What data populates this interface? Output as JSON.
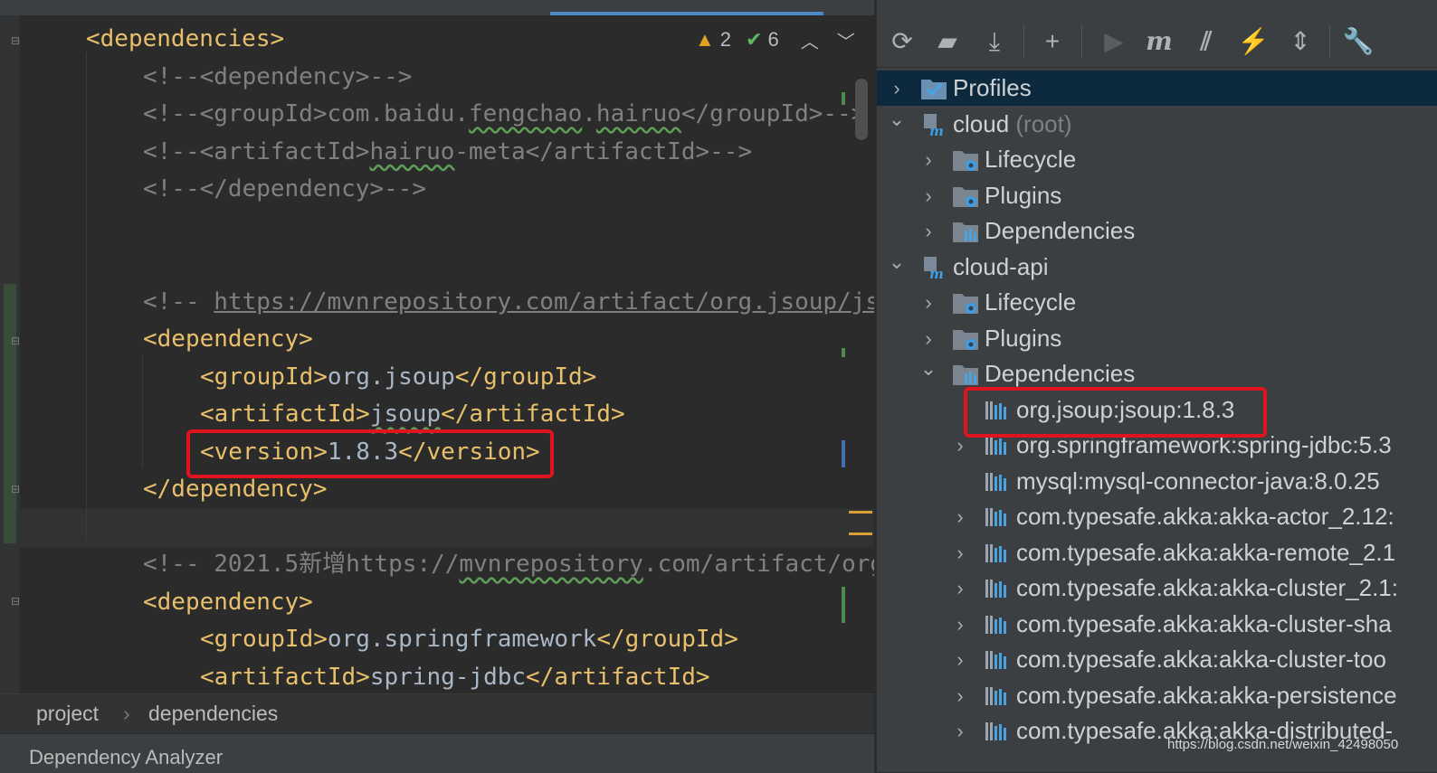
{
  "editor": {
    "inspection": {
      "warnings": "2",
      "ok": "6"
    },
    "lines": [
      {
        "segments": [
          {
            "t": "<dependencies>",
            "c": "tag"
          }
        ]
      },
      {
        "segments": [
          {
            "t": "<!--<dependency>-->",
            "c": "cmt"
          }
        ]
      },
      {
        "segments": [
          {
            "t": "<!--<groupId>com.baidu.",
            "c": "cmt"
          },
          {
            "t": "fengchao",
            "c": "cmt wavy"
          },
          {
            "t": ".",
            "c": "cmt"
          },
          {
            "t": "hairuo",
            "c": "cmt wavy"
          },
          {
            "t": "</groupId>-->",
            "c": "cmt"
          }
        ]
      },
      {
        "segments": [
          {
            "t": "<!--<artifactId>",
            "c": "cmt"
          },
          {
            "t": "hairuo",
            "c": "cmt wavy"
          },
          {
            "t": "-meta</artifactId>-->",
            "c": "cmt"
          }
        ]
      },
      {
        "segments": [
          {
            "t": "<!--</dependency>-->",
            "c": "cmt"
          }
        ]
      },
      {
        "segments": []
      },
      {
        "segments": []
      },
      {
        "segments": [
          {
            "t": "<!-- ",
            "c": "cmt"
          },
          {
            "t": "https://mvnrepository.com/artifact/org.jsoup/jsoup",
            "c": "url"
          }
        ]
      },
      {
        "segments": [
          {
            "t": "<dependency>",
            "c": "tag"
          }
        ]
      },
      {
        "segments": [
          {
            "t": "<groupId>",
            "c": "tag"
          },
          {
            "t": "org.jsoup",
            "c": "txt"
          },
          {
            "t": "</groupId>",
            "c": "tag"
          }
        ]
      },
      {
        "segments": [
          {
            "t": "<artifactId>",
            "c": "tag"
          },
          {
            "t": "jsoup",
            "c": "txt wavy"
          },
          {
            "t": "</artifactId>",
            "c": "tag"
          }
        ]
      },
      {
        "segments": [
          {
            "t": "<version>",
            "c": "tag"
          },
          {
            "t": "1.8.3",
            "c": "txt"
          },
          {
            "t": "</version>",
            "c": "tag"
          }
        ]
      },
      {
        "segments": [
          {
            "t": "</dependency>",
            "c": "tag"
          }
        ]
      },
      {
        "segments": []
      },
      {
        "segments": [
          {
            "t": "<!-- 2021.5新增https://",
            "c": "cmt"
          },
          {
            "t": "mvnrepository",
            "c": "cmt wavy"
          },
          {
            "t": ".com/artifact/org",
            "c": "cmt"
          }
        ]
      },
      {
        "segments": [
          {
            "t": "<dependency>",
            "c": "tag"
          }
        ]
      },
      {
        "segments": [
          {
            "t": "<groupId>",
            "c": "tag"
          },
          {
            "t": "org.springframework",
            "c": "txt"
          },
          {
            "t": "</groupId>",
            "c": "tag"
          }
        ]
      },
      {
        "segments": [
          {
            "t": "<artifactId>",
            "c": "tag"
          },
          {
            "t": "spring-jdbc",
            "c": "txt"
          },
          {
            "t": "</artifactId>",
            "c": "tag"
          }
        ]
      }
    ]
  },
  "breadcrumb": {
    "items": [
      "project",
      "dependencies"
    ],
    "separator": "›"
  },
  "bottom_tool": {
    "label": "Dependency Analyzer"
  },
  "maven": {
    "toolbar_icons": [
      "reload-icon",
      "generate-sources-icon",
      "download-icon",
      "add-icon",
      "run-icon",
      "maven-goal-icon",
      "toggle-offline-icon",
      "skip-tests-icon",
      "collapse-all-icon",
      "settings-icon"
    ],
    "tree": [
      {
        "label": "Profiles",
        "chev": "›",
        "icon": "profiles",
        "selected": true
      },
      {
        "label": "cloud",
        "suffix": " (root)",
        "chev": "⌄",
        "icon": "module"
      },
      {
        "label": "Lifecycle",
        "chev": "›",
        "icon": "folder-gear"
      },
      {
        "label": "Plugins",
        "chev": "›",
        "icon": "folder-gear"
      },
      {
        "label": "Dependencies",
        "chev": "›",
        "icon": "folder-bars"
      },
      {
        "label": "cloud-api",
        "chev": "⌄",
        "icon": "module"
      },
      {
        "label": "Lifecycle",
        "chev": "›",
        "icon": "folder-gear"
      },
      {
        "label": "Plugins",
        "chev": "›",
        "icon": "folder-gear"
      },
      {
        "label": "Dependencies",
        "chev": "⌄",
        "icon": "folder-bars"
      },
      {
        "label": "org.jsoup:jsoup:1.8.3",
        "chev": "",
        "icon": "library"
      },
      {
        "label": "org.springframework:spring-jdbc:5.3",
        "chev": "›",
        "icon": "library"
      },
      {
        "label": "mysql:mysql-connector-java:8.0.25",
        "chev": "",
        "icon": "library"
      },
      {
        "label": "com.typesafe.akka:akka-actor_2.12:",
        "chev": "›",
        "icon": "library"
      },
      {
        "label": "com.typesafe.akka:akka-remote_2.1",
        "chev": "›",
        "icon": "library"
      },
      {
        "label": "com.typesafe.akka:akka-cluster_2.1:",
        "chev": "›",
        "icon": "library"
      },
      {
        "label": "com.typesafe.akka:akka-cluster-sha",
        "chev": "›",
        "icon": "library"
      },
      {
        "label": "com.typesafe.akka:akka-cluster-too",
        "chev": "›",
        "icon": "library"
      },
      {
        "label": "com.typesafe.akka:akka-persistence",
        "chev": "›",
        "icon": "library"
      },
      {
        "label": "com.typesafe.akka:akka-distributed-",
        "chev": "›",
        "icon": "library"
      }
    ]
  },
  "watermark": "https://blog.csdn.net/weixin_42498050",
  "colors": {
    "highlight": "#e0141e",
    "selection": "#0d293e",
    "tag": "#e8bf6a",
    "comment": "#808080"
  }
}
